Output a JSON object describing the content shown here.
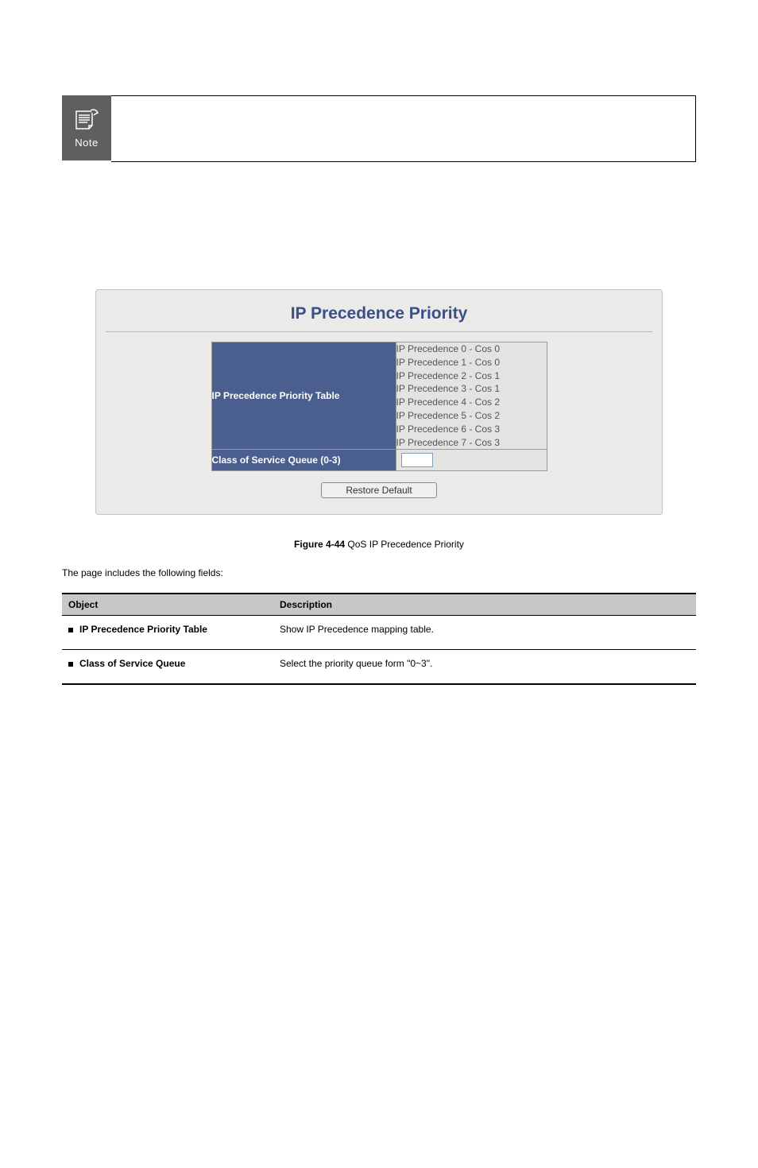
{
  "note": {
    "label": "Note"
  },
  "figure": {
    "title": "IP Precedence Priority",
    "rows": {
      "ip_precedence_key": "IP Precedence Priority Table",
      "ip_precedence_lines": [
        "IP Precedence 0 - Cos 0",
        "IP Precedence 1 - Cos 0",
        "IP Precedence 2 - Cos 1",
        "IP Precedence 3 - Cos 1",
        "IP Precedence 4 - Cos 2",
        "IP Precedence 5 - Cos 2",
        "IP Precedence 6 - Cos 3",
        "IP Precedence 7 - Cos 3"
      ],
      "cos_queue_key": "Class of Service Queue (0-3)",
      "cos_queue_value": ""
    },
    "button": "Restore Default",
    "caption_bold": "Figure 4-44",
    "caption_rest": " QoS IP Precedence Priority"
  },
  "body_text": "The page includes the following fields:",
  "desc_table": {
    "header_object": "Object",
    "header_description": "Description",
    "rows": [
      {
        "object": "IP Precedence Priority Table",
        "description": "Show IP Precedence mapping table."
      },
      {
        "object": "Class of Service Queue",
        "description": "Select the priority queue form \"0~3\"."
      }
    ]
  }
}
